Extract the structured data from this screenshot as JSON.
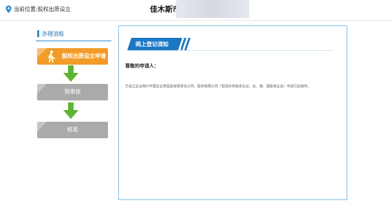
{
  "header": {
    "location_prefix": "当前位置:",
    "breadcrumb": "股权出质设立",
    "city": "佳木斯市"
  },
  "process": {
    "title": "办理流程",
    "steps": [
      {
        "label": "股权出质设立申请",
        "state": "active"
      },
      {
        "label": "预审核",
        "state": "pending"
      },
      {
        "label": "核准",
        "state": "pending"
      }
    ]
  },
  "notice": {
    "title": "网上登记须知",
    "greeting": "尊敬的申请人：",
    "body": "已设立企业用户开展企业类型是有限责任公司、股份有限公司（包括外商投资企业，台、港、澳投资企业）可进行此操作。"
  },
  "colors": {
    "accent": "#1b78c4",
    "active_step": "#f29b29",
    "pending_step": "#aaaaaa",
    "arrow": "#5cb531"
  }
}
